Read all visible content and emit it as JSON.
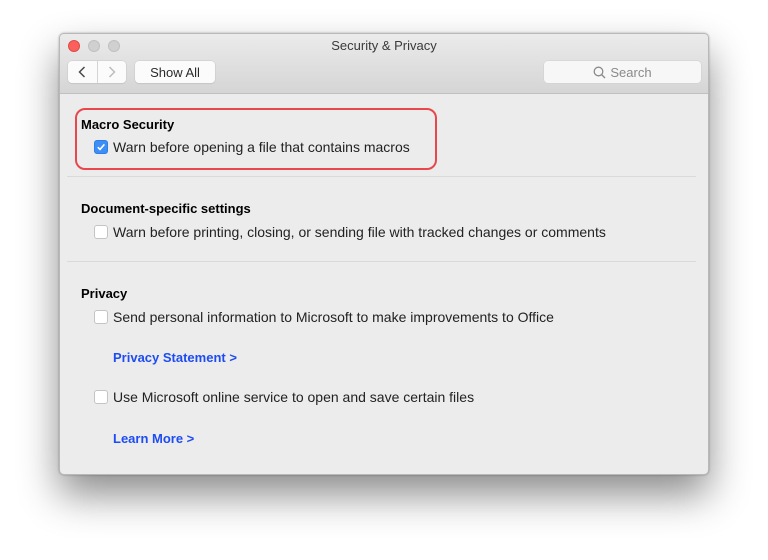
{
  "window": {
    "title": "Security & Privacy"
  },
  "toolbar": {
    "back_icon": "chevron-left-icon",
    "forward_icon": "chevron-right-icon",
    "show_all_label": "Show All",
    "search_placeholder": "Search",
    "search_icon": "search-icon"
  },
  "sections": {
    "macro": {
      "title": "Macro Security",
      "option": {
        "label": "Warn before opening a file that contains macros",
        "checked": true
      },
      "highlight_color": "#e8484c"
    },
    "document": {
      "title": "Document-specific settings",
      "option": {
        "label": "Warn before printing, closing, or sending file with tracked changes or comments",
        "checked": false
      }
    },
    "privacy": {
      "title": "Privacy",
      "option1": {
        "label": "Send personal information to Microsoft to make improvements to Office",
        "checked": false
      },
      "link1": "Privacy Statement >",
      "option2": {
        "label": "Use Microsoft online service to open and save certain files",
        "checked": false
      },
      "link2": "Learn More >"
    }
  },
  "colors": {
    "link": "#1d4cf2",
    "checkbox_checked": "#3d8ef7",
    "close_button": "#fc605c"
  }
}
